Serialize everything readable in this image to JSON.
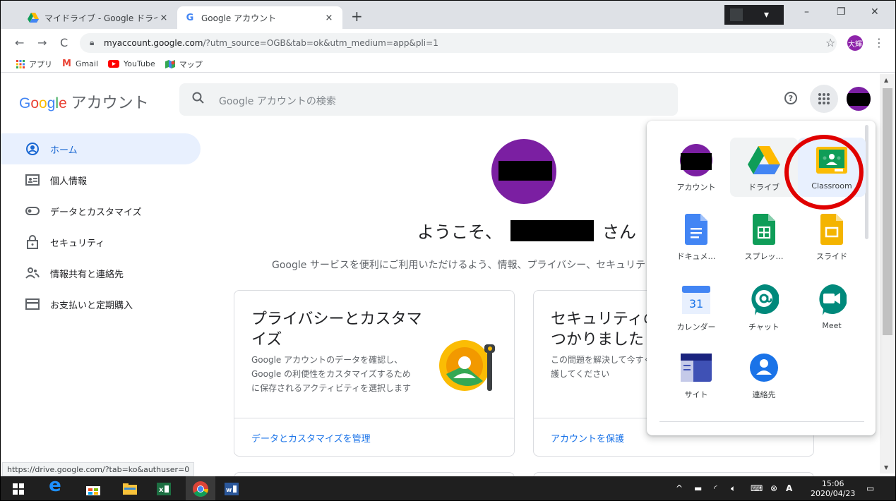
{
  "browser": {
    "tabs": [
      {
        "title": "マイドライブ - Google ドライブ",
        "close": "×"
      },
      {
        "title": "Google アカウント",
        "close": "×"
      }
    ],
    "new_tab": "+",
    "window_controls": {
      "minimize": "–",
      "restore": "❐",
      "close": "✕"
    },
    "nav": {
      "back": "←",
      "forward": "→",
      "reload": "C"
    },
    "url": {
      "host": "myaccount.google.com",
      "rest": "/?utm_source=OGB&tab=ok&utm_medium=app&pli=1"
    },
    "profile_initials": "大輝",
    "bookmarks": [
      {
        "label": "アプリ",
        "icon": "apps-grid-icon"
      },
      {
        "label": "Gmail",
        "icon": "gmail-icon"
      },
      {
        "label": "YouTube",
        "icon": "youtube-icon"
      },
      {
        "label": "マップ",
        "icon": "maps-icon"
      }
    ],
    "status_url": "https://drive.google.com/?tab=ko&authuser=0"
  },
  "header": {
    "logo_google": "Google",
    "logo_account": "アカウント",
    "search_placeholder": "Google アカウントの検索",
    "help": "?"
  },
  "sidebar": {
    "items": [
      {
        "label": "ホーム",
        "icon": "home-icon",
        "active": true
      },
      {
        "label": "個人情報",
        "icon": "id-card-icon"
      },
      {
        "label": "データとカスタマイズ",
        "icon": "toggle-icon"
      },
      {
        "label": "セキュリティ",
        "icon": "lock-icon"
      },
      {
        "label": "情報共有と連絡先",
        "icon": "people-icon"
      },
      {
        "label": "お支払いと定期購入",
        "icon": "card-icon"
      }
    ]
  },
  "main": {
    "welcome_prefix": "ようこそ、",
    "welcome_suffix": "さん",
    "subtitle": "Google サービスを便利にご利用いただけるよう、情報、プライバシー、セキュリティを管理できます",
    "cards": [
      {
        "title": "プライバシーとカスタマイズ",
        "desc": "Google アカウントのデータを確認し、Google の利便性をカスタマイズするために保存されるアクティビティを選択します",
        "link": "データとカスタマイズを管理"
      },
      {
        "title": "セキュリティの問題が見つかりました",
        "desc": "この問題を解決して今すぐアカウントを保護してください",
        "link": "アカウントを保護"
      }
    ]
  },
  "apps_panel": {
    "apps": [
      {
        "label": "アカウント",
        "icon": "account-icon"
      },
      {
        "label": "ドライブ",
        "icon": "drive-icon"
      },
      {
        "label": "Classroom",
        "icon": "classroom-icon"
      },
      {
        "label": "ドキュメ…",
        "icon": "docs-icon"
      },
      {
        "label": "スプレッ…",
        "icon": "sheets-icon"
      },
      {
        "label": "スライド",
        "icon": "slides-icon"
      },
      {
        "label": "カレンダー",
        "icon": "calendar-icon",
        "badge": "31"
      },
      {
        "label": "チャット",
        "icon": "chat-icon"
      },
      {
        "label": "Meet",
        "icon": "meet-icon"
      },
      {
        "label": "サイト",
        "icon": "sites-icon"
      },
      {
        "label": "連絡先",
        "icon": "contacts-icon"
      }
    ]
  },
  "taskbar": {
    "clock_time": "15:06",
    "clock_date": "2020/04/23"
  },
  "colors": {
    "accent": "#1a73e8",
    "highlight_ring": "#e00000",
    "avatar": "#7b1fa2"
  }
}
